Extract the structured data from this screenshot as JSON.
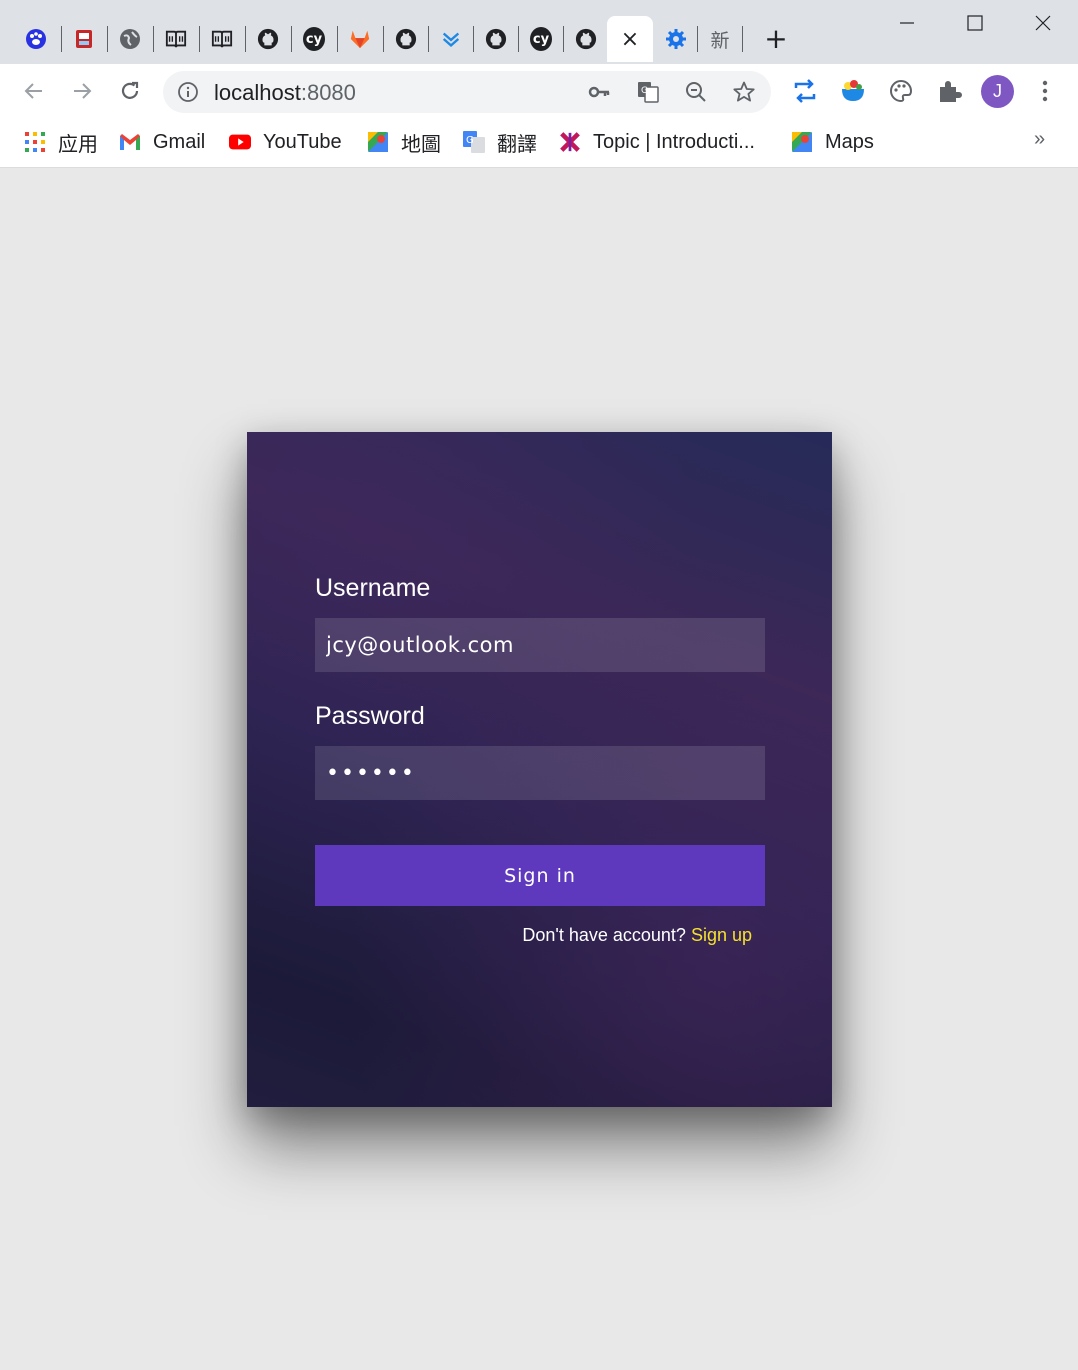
{
  "browser": {
    "tabs": [
      {
        "icon": "baidu-icon"
      },
      {
        "icon": "site-logo-icon"
      },
      {
        "icon": "globe-icon"
      },
      {
        "icon": "book-icon"
      },
      {
        "icon": "book-icon"
      },
      {
        "icon": "github-icon"
      },
      {
        "icon": "cypress-icon",
        "glyph": "cy"
      },
      {
        "icon": "gitlab-icon"
      },
      {
        "icon": "github-icon"
      },
      {
        "icon": "download-icon"
      },
      {
        "icon": "github-icon"
      },
      {
        "icon": "cypress-icon",
        "glyph": "cy"
      },
      {
        "icon": "github-icon"
      }
    ],
    "active_tab_close": "×",
    "extra_tab_title": "新",
    "new_tab": "+",
    "address": {
      "host": "localhost",
      "port": ":8080"
    },
    "avatar_letter": "J",
    "accent_color": "#7e57c2"
  },
  "bookmarks": [
    {
      "label": "应用",
      "icon": "apps-grid-icon"
    },
    {
      "label": "Gmail",
      "icon": "gmail-icon"
    },
    {
      "label": "YouTube",
      "icon": "youtube-icon"
    },
    {
      "label": "地圖",
      "icon": "maps-icon"
    },
    {
      "label": "翻譯",
      "icon": "translate-icon"
    },
    {
      "label": "Topic | Introducti...",
      "icon": "topic-icon"
    },
    {
      "label": "Maps",
      "icon": "maps-icon"
    }
  ],
  "bookmarks_more": "»",
  "login": {
    "username_label": "Username",
    "username_value": "jcy@outlook.com",
    "password_label": "Password",
    "password_value": "••••••",
    "signin_label": "Sign in",
    "signup_prompt": "Don't have account? ",
    "signup_link": "Sign up",
    "button_color": "#5e39bd",
    "link_color": "#f5e12a"
  }
}
